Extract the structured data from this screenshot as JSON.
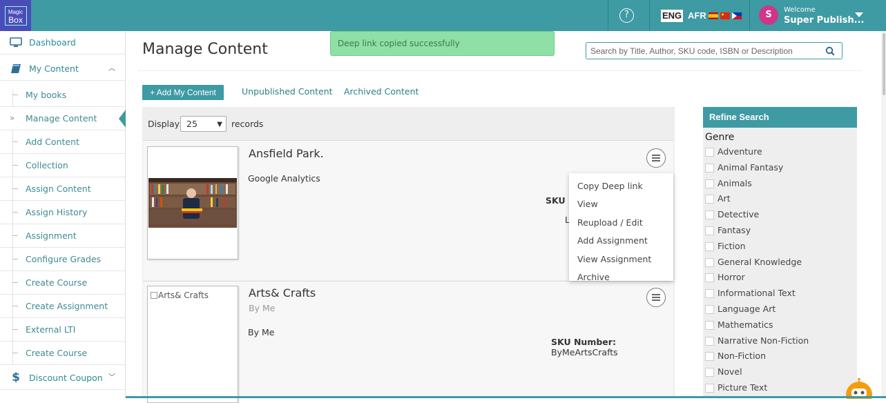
{
  "header": {
    "logo_line1": "Magic",
    "logo_line2": "Box",
    "help_icon": "question-circle-icon",
    "languages": [
      "ENG",
      "AFR"
    ],
    "avatar_letter": "S",
    "welcome": "Welcome",
    "username": "Super Publish..."
  },
  "sidebar": {
    "items": [
      {
        "label": "Dashboard",
        "icon": "monitor-icon"
      },
      {
        "label": "My Content",
        "icon": "book-icon"
      },
      {
        "label": "My books"
      },
      {
        "label": "Manage Content"
      },
      {
        "label": "Add Content"
      },
      {
        "label": "Collection"
      },
      {
        "label": "Assign Content"
      },
      {
        "label": "Assign History"
      },
      {
        "label": "Assignment"
      },
      {
        "label": "Configure Grades"
      },
      {
        "label": "Create Course"
      },
      {
        "label": "Create Assignment"
      },
      {
        "label": "External LTI"
      },
      {
        "label": "Create Course"
      },
      {
        "label": "Discount Coupon",
        "icon": "dollar-icon"
      }
    ]
  },
  "main": {
    "title": "Manage Content",
    "toast": "Deep link copied successfully",
    "search_placeholder": "Search by Title, Author, SKU code, ISBN or Description",
    "add_button": "+ Add My Content",
    "tabs": [
      "Unpublished Content",
      "Archived Content"
    ],
    "display_label": "Display",
    "display_value": "25",
    "records_label": "records",
    "cards": [
      {
        "title": "Ansfield Park.",
        "description": "Google Analytics",
        "sku_label": "SKU N",
        "extra": "L"
      },
      {
        "title": "Arts& Crafts",
        "author": "By Me",
        "description": "By Me",
        "image_alt": "Arts& Crafts",
        "sku_label": "SKU Number:",
        "sku_value": "ByMeArtsCrafts"
      }
    ],
    "menu_items": [
      "Copy Deep link",
      "View",
      "Reupload / Edit",
      "Add Assignment",
      "View Assignment",
      "Archive"
    ]
  },
  "refine": {
    "title": "Refine Search",
    "genre_label": "Genre",
    "genres": [
      "Adventure",
      "Animal Fantasy",
      "Animals",
      "Art",
      "Detective",
      "Fantasy",
      "Fiction",
      "General Knowledge",
      "Horror",
      "Informational Text",
      "Language Art",
      "Mathematics",
      "Narrative Non-Fiction",
      "Non-Fiction",
      "Novel",
      "Picture Text"
    ]
  },
  "colors": {
    "primary": "#3e9aa3",
    "toast_bg": "#8fe0a6",
    "avatar": "#d0358a"
  }
}
